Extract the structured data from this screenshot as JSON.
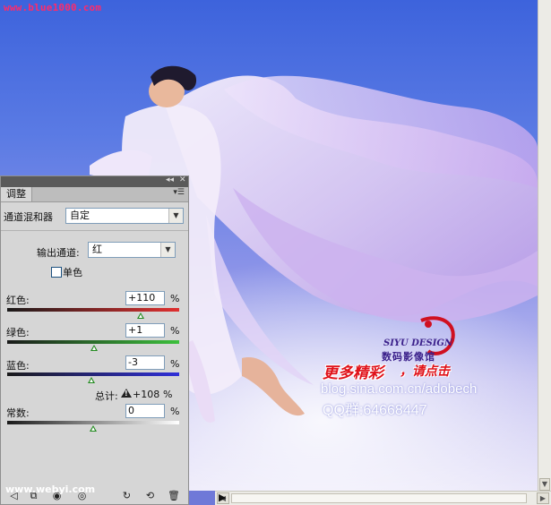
{
  "canvas": {
    "watermark_top": "www.blue1000.com",
    "watermark_bottom": "www.webyi.com",
    "logo_en": "SIYU DESIGN",
    "logo_cn": "数码影像馆",
    "promo_text": "更多精彩",
    "promo_click": "，请点击",
    "blog_url": "blog.sina.com.cn/adobech",
    "qq_text": "QQ群:64668447"
  },
  "panel": {
    "tab_title": "调整",
    "adjustment_name": "通道混和器",
    "preset_value": "自定",
    "output_channel_label": "输出通道:",
    "output_channel_value": "红",
    "monochrome_label": "单色",
    "monochrome_checked": false,
    "sliders": [
      {
        "label": "红色:",
        "value": "+110",
        "unit": "%",
        "level": 0.775,
        "track_color": "red"
      },
      {
        "label": "绿色:",
        "value": "+1",
        "unit": "%",
        "level": 0.505,
        "track_color": "green"
      },
      {
        "label": "蓝色:",
        "value": "-3",
        "unit": "%",
        "level": 0.49,
        "track_color": "blue"
      }
    ],
    "total_label": "总计:",
    "total_value": "+108",
    "total_unit": "%",
    "constant_label": "常数:",
    "constant_value": "0",
    "constant_unit": "%",
    "constant_level": 0.5
  },
  "icons": {
    "panel_collapse": "double-chevron-left-icon",
    "panel_close": "close-icon",
    "panel_menu": "panel-menu-icon",
    "footer": [
      "back-icon",
      "clip-icon",
      "visibility-icon",
      "eye-icon",
      "redo-icon",
      "reset-icon",
      "trash-icon"
    ]
  }
}
